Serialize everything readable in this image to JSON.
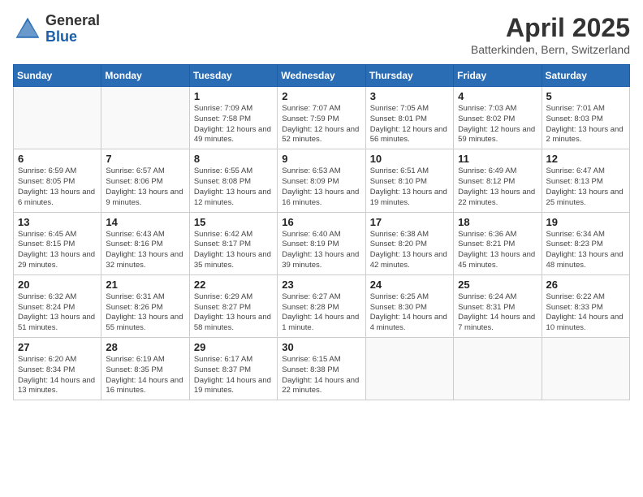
{
  "logo": {
    "general": "General",
    "blue": "Blue"
  },
  "title": {
    "month": "April 2025",
    "location": "Batterkinden, Bern, Switzerland"
  },
  "weekdays": [
    "Sunday",
    "Monday",
    "Tuesday",
    "Wednesday",
    "Thursday",
    "Friday",
    "Saturday"
  ],
  "weeks": [
    [
      {
        "day": "",
        "sunrise": "",
        "sunset": "",
        "daylight": ""
      },
      {
        "day": "",
        "sunrise": "",
        "sunset": "",
        "daylight": ""
      },
      {
        "day": "1",
        "sunrise": "Sunrise: 7:09 AM",
        "sunset": "Sunset: 7:58 PM",
        "daylight": "Daylight: 12 hours and 49 minutes."
      },
      {
        "day": "2",
        "sunrise": "Sunrise: 7:07 AM",
        "sunset": "Sunset: 7:59 PM",
        "daylight": "Daylight: 12 hours and 52 minutes."
      },
      {
        "day": "3",
        "sunrise": "Sunrise: 7:05 AM",
        "sunset": "Sunset: 8:01 PM",
        "daylight": "Daylight: 12 hours and 56 minutes."
      },
      {
        "day": "4",
        "sunrise": "Sunrise: 7:03 AM",
        "sunset": "Sunset: 8:02 PM",
        "daylight": "Daylight: 12 hours and 59 minutes."
      },
      {
        "day": "5",
        "sunrise": "Sunrise: 7:01 AM",
        "sunset": "Sunset: 8:03 PM",
        "daylight": "Daylight: 13 hours and 2 minutes."
      }
    ],
    [
      {
        "day": "6",
        "sunrise": "Sunrise: 6:59 AM",
        "sunset": "Sunset: 8:05 PM",
        "daylight": "Daylight: 13 hours and 6 minutes."
      },
      {
        "day": "7",
        "sunrise": "Sunrise: 6:57 AM",
        "sunset": "Sunset: 8:06 PM",
        "daylight": "Daylight: 13 hours and 9 minutes."
      },
      {
        "day": "8",
        "sunrise": "Sunrise: 6:55 AM",
        "sunset": "Sunset: 8:08 PM",
        "daylight": "Daylight: 13 hours and 12 minutes."
      },
      {
        "day": "9",
        "sunrise": "Sunrise: 6:53 AM",
        "sunset": "Sunset: 8:09 PM",
        "daylight": "Daylight: 13 hours and 16 minutes."
      },
      {
        "day": "10",
        "sunrise": "Sunrise: 6:51 AM",
        "sunset": "Sunset: 8:10 PM",
        "daylight": "Daylight: 13 hours and 19 minutes."
      },
      {
        "day": "11",
        "sunrise": "Sunrise: 6:49 AM",
        "sunset": "Sunset: 8:12 PM",
        "daylight": "Daylight: 13 hours and 22 minutes."
      },
      {
        "day": "12",
        "sunrise": "Sunrise: 6:47 AM",
        "sunset": "Sunset: 8:13 PM",
        "daylight": "Daylight: 13 hours and 25 minutes."
      }
    ],
    [
      {
        "day": "13",
        "sunrise": "Sunrise: 6:45 AM",
        "sunset": "Sunset: 8:15 PM",
        "daylight": "Daylight: 13 hours and 29 minutes."
      },
      {
        "day": "14",
        "sunrise": "Sunrise: 6:43 AM",
        "sunset": "Sunset: 8:16 PM",
        "daylight": "Daylight: 13 hours and 32 minutes."
      },
      {
        "day": "15",
        "sunrise": "Sunrise: 6:42 AM",
        "sunset": "Sunset: 8:17 PM",
        "daylight": "Daylight: 13 hours and 35 minutes."
      },
      {
        "day": "16",
        "sunrise": "Sunrise: 6:40 AM",
        "sunset": "Sunset: 8:19 PM",
        "daylight": "Daylight: 13 hours and 39 minutes."
      },
      {
        "day": "17",
        "sunrise": "Sunrise: 6:38 AM",
        "sunset": "Sunset: 8:20 PM",
        "daylight": "Daylight: 13 hours and 42 minutes."
      },
      {
        "day": "18",
        "sunrise": "Sunrise: 6:36 AM",
        "sunset": "Sunset: 8:21 PM",
        "daylight": "Daylight: 13 hours and 45 minutes."
      },
      {
        "day": "19",
        "sunrise": "Sunrise: 6:34 AM",
        "sunset": "Sunset: 8:23 PM",
        "daylight": "Daylight: 13 hours and 48 minutes."
      }
    ],
    [
      {
        "day": "20",
        "sunrise": "Sunrise: 6:32 AM",
        "sunset": "Sunset: 8:24 PM",
        "daylight": "Daylight: 13 hours and 51 minutes."
      },
      {
        "day": "21",
        "sunrise": "Sunrise: 6:31 AM",
        "sunset": "Sunset: 8:26 PM",
        "daylight": "Daylight: 13 hours and 55 minutes."
      },
      {
        "day": "22",
        "sunrise": "Sunrise: 6:29 AM",
        "sunset": "Sunset: 8:27 PM",
        "daylight": "Daylight: 13 hours and 58 minutes."
      },
      {
        "day": "23",
        "sunrise": "Sunrise: 6:27 AM",
        "sunset": "Sunset: 8:28 PM",
        "daylight": "Daylight: 14 hours and 1 minute."
      },
      {
        "day": "24",
        "sunrise": "Sunrise: 6:25 AM",
        "sunset": "Sunset: 8:30 PM",
        "daylight": "Daylight: 14 hours and 4 minutes."
      },
      {
        "day": "25",
        "sunrise": "Sunrise: 6:24 AM",
        "sunset": "Sunset: 8:31 PM",
        "daylight": "Daylight: 14 hours and 7 minutes."
      },
      {
        "day": "26",
        "sunrise": "Sunrise: 6:22 AM",
        "sunset": "Sunset: 8:33 PM",
        "daylight": "Daylight: 14 hours and 10 minutes."
      }
    ],
    [
      {
        "day": "27",
        "sunrise": "Sunrise: 6:20 AM",
        "sunset": "Sunset: 8:34 PM",
        "daylight": "Daylight: 14 hours and 13 minutes."
      },
      {
        "day": "28",
        "sunrise": "Sunrise: 6:19 AM",
        "sunset": "Sunset: 8:35 PM",
        "daylight": "Daylight: 14 hours and 16 minutes."
      },
      {
        "day": "29",
        "sunrise": "Sunrise: 6:17 AM",
        "sunset": "Sunset: 8:37 PM",
        "daylight": "Daylight: 14 hours and 19 minutes."
      },
      {
        "day": "30",
        "sunrise": "Sunrise: 6:15 AM",
        "sunset": "Sunset: 8:38 PM",
        "daylight": "Daylight: 14 hours and 22 minutes."
      },
      {
        "day": "",
        "sunrise": "",
        "sunset": "",
        "daylight": ""
      },
      {
        "day": "",
        "sunrise": "",
        "sunset": "",
        "daylight": ""
      },
      {
        "day": "",
        "sunrise": "",
        "sunset": "",
        "daylight": ""
      }
    ]
  ]
}
